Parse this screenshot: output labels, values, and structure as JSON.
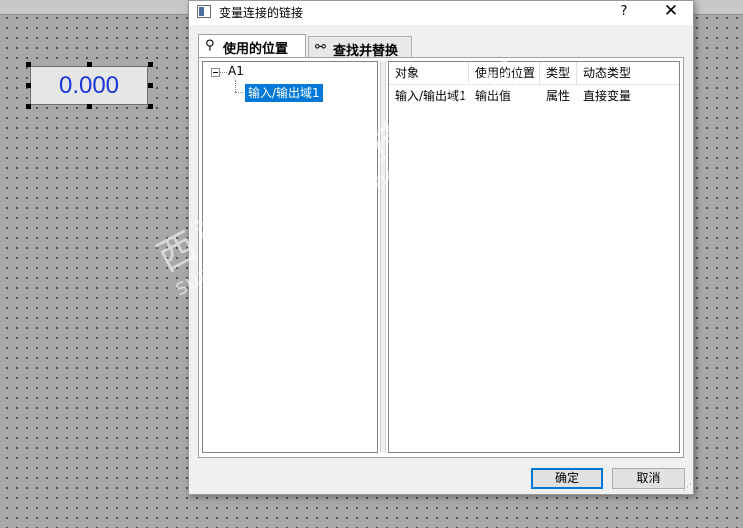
{
  "canvas": {
    "io_field_value": "0.000",
    "io_field_text_color": "#1a36d8"
  },
  "dialog": {
    "title": "变量连接的链接",
    "help_label": "?",
    "close_label": "✕",
    "tabs": [
      {
        "label": "使用的位置",
        "icon": "pin-icon",
        "active": true
      },
      {
        "label": "查找并替换",
        "icon": "binoculars-icon",
        "active": false
      }
    ],
    "tree": {
      "root_label": "A1",
      "child_label": "输入/输出域1",
      "selection_color": "#0078d7"
    },
    "list": {
      "columns": [
        "对象",
        "使用的位置",
        "类型",
        "动态类型"
      ],
      "rows": [
        [
          "输入/输出域1",
          "输出值",
          "属性",
          "直接变量"
        ]
      ]
    },
    "buttons": {
      "ok_label": "确定",
      "cancel_label": "取消",
      "ok_border_color": "#0078d7"
    }
  },
  "watermark": {
    "text_cn": "西门子工业 技术论坛",
    "text_url": "support.industry.siemens.com/cs"
  }
}
